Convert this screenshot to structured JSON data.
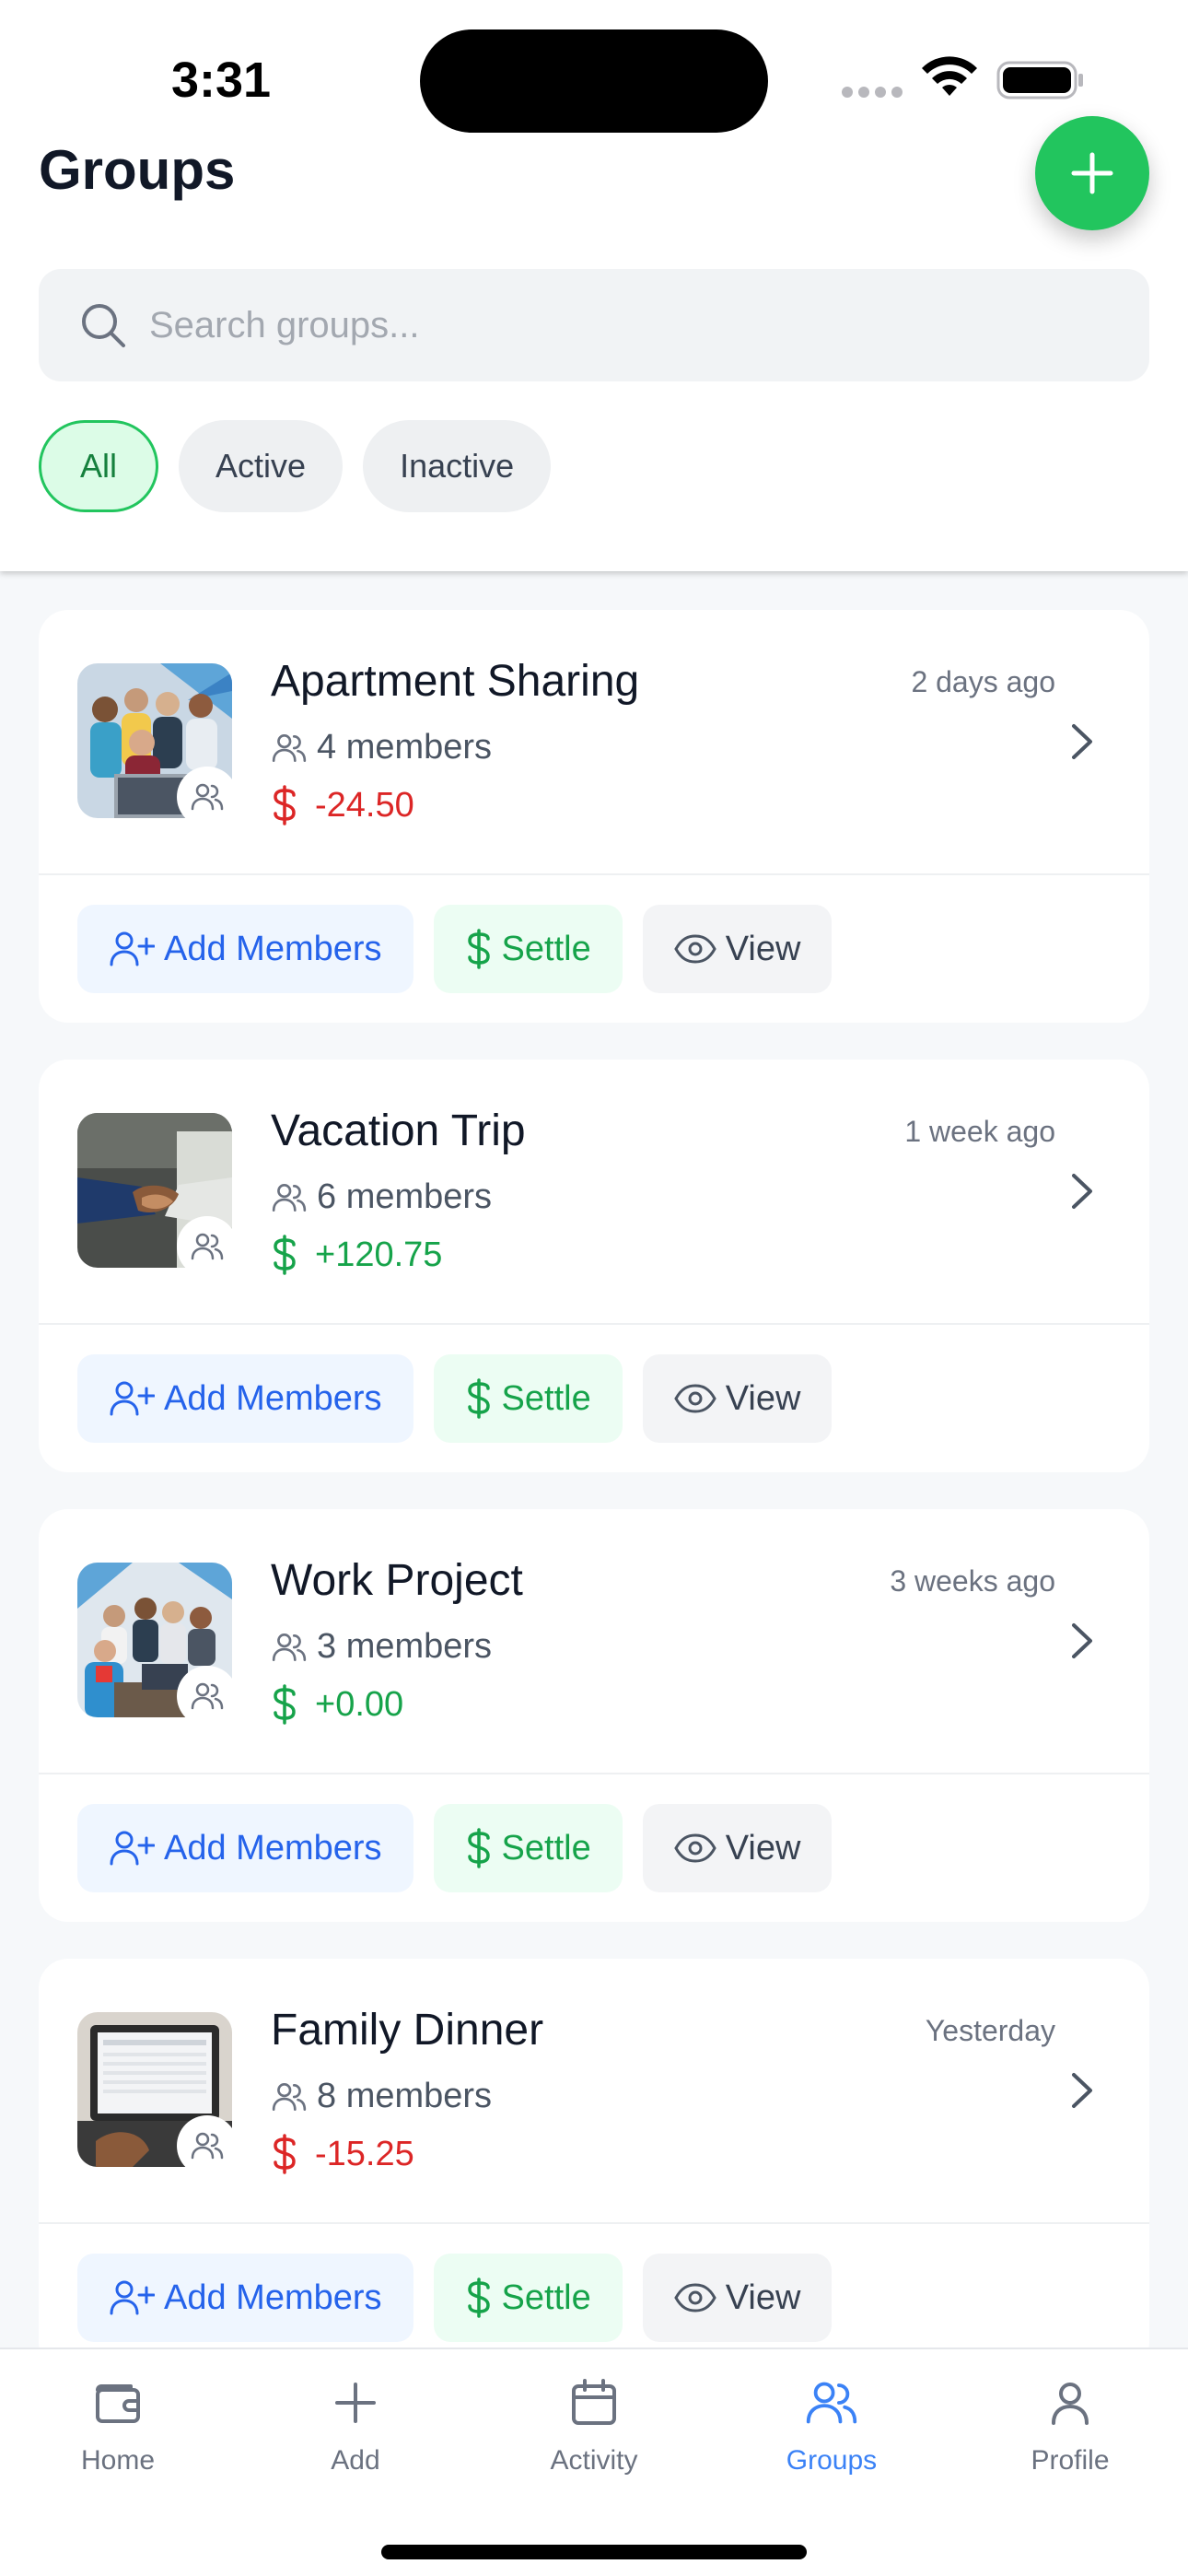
{
  "status_bar": {
    "time": "3:31"
  },
  "header": {
    "title": "Groups",
    "search_placeholder": "Search groups...",
    "filters": [
      "All",
      "Active",
      "Inactive"
    ],
    "active_filter": "All"
  },
  "groups": [
    {
      "name": "Apartment Sharing",
      "members": "4 members",
      "time": "2 days ago",
      "balance": "-24.50",
      "balance_sign": "negative"
    },
    {
      "name": "Vacation Trip",
      "members": "6 members",
      "time": "1 week ago",
      "balance": "+120.75",
      "balance_sign": "positive"
    },
    {
      "name": "Work Project",
      "members": "3 members",
      "time": "3 weeks ago",
      "balance": "+0.00",
      "balance_sign": "positive"
    },
    {
      "name": "Family Dinner",
      "members": "8 members",
      "time": "Yesterday",
      "balance": "-15.25",
      "balance_sign": "negative"
    }
  ],
  "actions": {
    "add_members": "Add Members",
    "settle": "Settle",
    "view": "View"
  },
  "tabbar": {
    "items": [
      {
        "label": "Home",
        "icon": "wallet-icon"
      },
      {
        "label": "Add",
        "icon": "plus-icon"
      },
      {
        "label": "Activity",
        "icon": "calendar-icon"
      },
      {
        "label": "Groups",
        "icon": "users-icon"
      },
      {
        "label": "Profile",
        "icon": "user-icon"
      }
    ],
    "active": "Groups"
  },
  "colors": {
    "accent_green": "#22c55e",
    "negative_red": "#dc2626",
    "positive_green": "#16a34a",
    "tab_active_blue": "#3b82f6"
  }
}
